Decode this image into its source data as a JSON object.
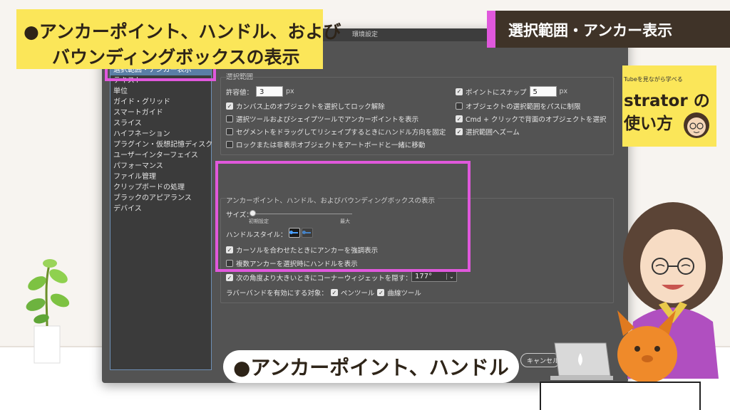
{
  "dialog": {
    "title": "環境設定",
    "cancel_label": "キャンセル"
  },
  "sidebar": {
    "items": [
      {
        "label": "選択範囲・アンカー表示",
        "selected": true
      },
      {
        "label": "テキスト"
      },
      {
        "label": "単位"
      },
      {
        "label": "ガイド・グリッド"
      },
      {
        "label": "スマートガイド"
      },
      {
        "label": "スライス"
      },
      {
        "label": "ハイフネーション"
      },
      {
        "label": "プラグイン・仮想記憶ディスク"
      },
      {
        "label": "ユーザーインターフェイス"
      },
      {
        "label": "パフォーマンス"
      },
      {
        "label": "ファイル管理"
      },
      {
        "label": "クリップボードの処理"
      },
      {
        "label": "ブラックのアピアランス"
      },
      {
        "label": "デバイス"
      }
    ]
  },
  "selection": {
    "heading": "選択範囲",
    "tolerance_label": "許容値：",
    "tolerance_value": "3",
    "tolerance_unit": "px",
    "snap_label": "ポイントにスナップ",
    "snap_checked": true,
    "snap_value": "5",
    "snap_unit": "px",
    "opt1": {
      "label": "カンバス上のオブジェクトを選択してロック解除",
      "checked": true
    },
    "opt2": {
      "label": "選択ツールおよびシェイプツールでアンカーポイントを表示",
      "checked": false
    },
    "opt3": {
      "label": "セグメントをドラッグしてリシェイプするときにハンドル方向を固定",
      "checked": false
    },
    "opt4": {
      "label": "ロックまたは非表示オブジェクトをアートボードと一緒に移動",
      "checked": false
    },
    "opt5": {
      "label": "オブジェクトの選択範囲をパスに制限",
      "checked": false
    },
    "opt6": {
      "label": "Cmd + クリックで背面のオブジェクトを選択",
      "checked": true
    },
    "opt7": {
      "label": "選択範囲へズーム",
      "checked": true
    }
  },
  "anchor": {
    "heading": "アンカーポイント、ハンドル、およびバウンディングボックスの表示",
    "size_label": "サイズ：",
    "size_min_label": "初期設定",
    "size_max_label": "最大",
    "size_level": 0,
    "handle_style_label": "ハンドルスタイル：",
    "opt1": {
      "label": "カーソルを合わせたときにアンカーを強調表示",
      "checked": true
    },
    "opt2": {
      "label": "複数アンカーを選択時にハンドルを表示",
      "checked": false
    },
    "opt3": {
      "label": "次の角度より大きいときにコーナーウィジェットを隠す：",
      "checked": true
    },
    "angle_value": "177°",
    "rubber_band_label": "ラバーバンドを有効にする対象：",
    "pen_label": "ペンツール",
    "pen_checked": true,
    "curve_label": "曲線ツール",
    "curve_checked": true
  },
  "banners": {
    "top_left_line1": "●アンカーポイント、ハンドル、および",
    "top_left_line2": "バウンディングボックスの表示",
    "top_right": "選択範囲・アンカー表示",
    "promo_line1": "Tubeを見ながら学べる",
    "promo_line2": "strator の",
    "promo_line3": "使い方",
    "caption": "●アンカーポイント、ハンドル"
  },
  "colors": {
    "highlight": "#e058dc",
    "banner_yellow": "#fbe659",
    "banner_dark": "#3f3328",
    "dialog_bg": "#535353"
  }
}
